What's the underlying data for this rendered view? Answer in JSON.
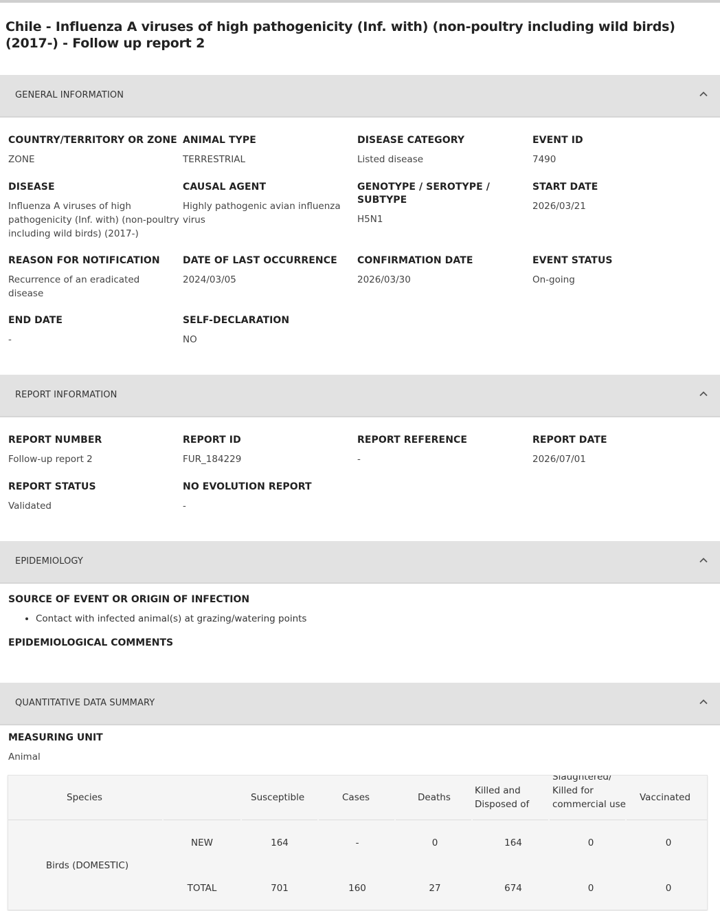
{
  "title": "Chile - Influenza A viruses of high pathogenicity (Inf. with) (non-poultry including wild birds) (2017-) - Follow up report 2",
  "sections": {
    "general": "GENERAL INFORMATION",
    "report": "REPORT INFORMATION",
    "epidemiology": "EPIDEMIOLOGY",
    "quantitative": "QUANTITATIVE DATA SUMMARY"
  },
  "general": {
    "country": {
      "label": "COUNTRY/TERRITORY OR ZONE",
      "value": "ZONE"
    },
    "animal_type": {
      "label": "ANIMAL TYPE",
      "value": "TERRESTRIAL"
    },
    "disease_category": {
      "label": "DISEASE CATEGORY",
      "value": "Listed disease"
    },
    "event_id": {
      "label": "EVENT ID",
      "value": "7490"
    },
    "disease": {
      "label": "DISEASE",
      "value": "Influenza A viruses of high pathogenicity (Inf. with) (non-poultry including wild birds) (2017-)"
    },
    "causal_agent": {
      "label": "CAUSAL AGENT",
      "value": "Highly pathogenic avian influenza virus"
    },
    "genotype": {
      "label": "GENOTYPE / SEROTYPE / SUBTYPE",
      "value": "H5N1"
    },
    "start_date": {
      "label": "START DATE",
      "value": "2026/03/21"
    },
    "reason": {
      "label": "REASON FOR NOTIFICATION",
      "value": "Recurrence of an eradicated disease"
    },
    "last_occurrence": {
      "label": "DATE OF LAST OCCURRENCE",
      "value": "2024/03/05"
    },
    "confirmation_date": {
      "label": "CONFIRMATION DATE",
      "value": "2026/03/30"
    },
    "event_status": {
      "label": "EVENT STATUS",
      "value": "On-going"
    },
    "end_date": {
      "label": "END DATE",
      "value": "-"
    },
    "self_declaration": {
      "label": "SELF-DECLARATION",
      "value": "NO"
    }
  },
  "report": {
    "report_number": {
      "label": "REPORT NUMBER",
      "value": "Follow-up report 2"
    },
    "report_id": {
      "label": "REPORT ID",
      "value": "FUR_184229"
    },
    "report_reference": {
      "label": "REPORT REFERENCE",
      "value": "-"
    },
    "report_date": {
      "label": "REPORT DATE",
      "value": "2026/07/01"
    },
    "report_status": {
      "label": "REPORT STATUS",
      "value": "Validated"
    },
    "no_evolution": {
      "label": "NO EVOLUTION REPORT",
      "value": "-"
    }
  },
  "epidemiology": {
    "source_label": "SOURCE OF EVENT OR ORIGIN OF INFECTION",
    "sources": [
      "Contact with infected animal(s) at grazing/watering points"
    ],
    "comments_label": "EPIDEMIOLOGICAL COMMENTS"
  },
  "quantitative": {
    "measuring_unit_label": "MEASURING UNIT",
    "measuring_unit_value": "Animal",
    "headers": {
      "species": "Species",
      "susceptible": "Susceptible",
      "cases": "Cases",
      "deaths": "Deaths",
      "killed": "Killed and Disposed of",
      "slaughtered": "Slaughtered/ Killed for commercial use",
      "vaccinated": "Vaccinated"
    },
    "species": "Birds (DOMESTIC)",
    "rows": [
      {
        "type": "NEW",
        "susceptible": "164",
        "cases": "-",
        "deaths": "0",
        "killed": "164",
        "slaughtered": "0",
        "vaccinated": "0"
      },
      {
        "type": "TOTAL",
        "susceptible": "701",
        "cases": "160",
        "deaths": "27",
        "killed": "674",
        "slaughtered": "0",
        "vaccinated": "0"
      }
    ]
  },
  "icons": {
    "collapse": "chevron-up-icon"
  }
}
